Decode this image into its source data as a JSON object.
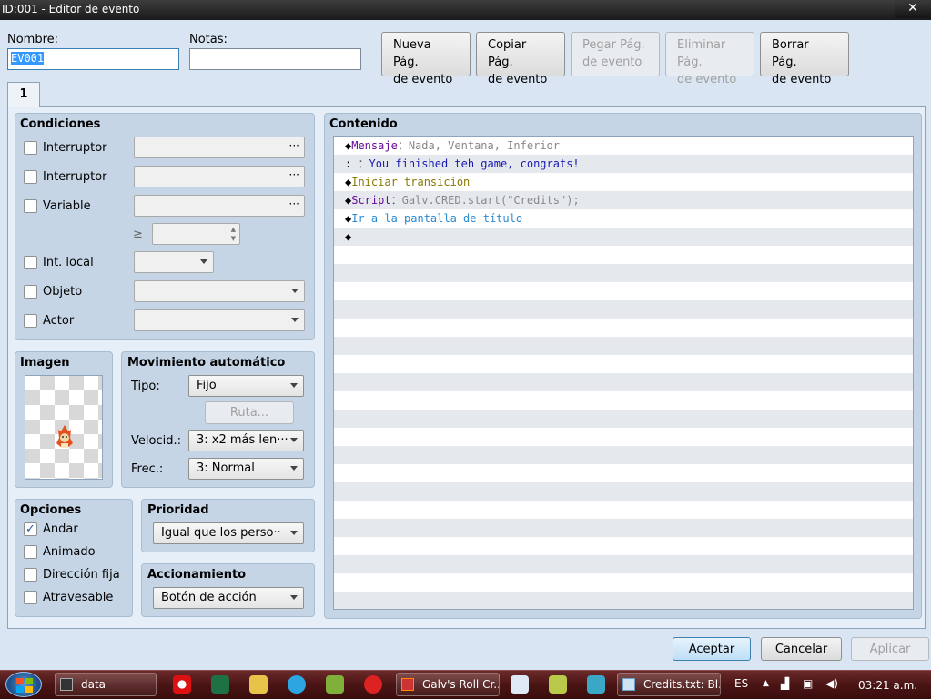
{
  "window": {
    "title": "ID:001 - Editor de evento",
    "close": "✕"
  },
  "form": {
    "name_label": "Nombre:",
    "name_value": "EV001",
    "notes_label": "Notas:",
    "notes_value": ""
  },
  "page_buttons": [
    {
      "line1": "Nueva Pág.",
      "line2": "de evento"
    },
    {
      "line1": "Copiar Pág.",
      "line2": "de evento"
    },
    {
      "line1": "Pegar Pág.",
      "line2": "de evento"
    },
    {
      "line1": "Eliminar Pág.",
      "line2": "de evento"
    },
    {
      "line1": "Borrar Pág.",
      "line2": "de evento"
    }
  ],
  "tabs": [
    "1"
  ],
  "conditions": {
    "title": "Condiciones",
    "switch1": "Interruptor",
    "switch2": "Interruptor",
    "variable": "Variable",
    "ge": "≥",
    "selfswitch": "Int. local",
    "item": "Objeto",
    "actor": "Actor",
    "dots": "···"
  },
  "image": {
    "title": "Imagen"
  },
  "movement": {
    "title": "Movimiento automático",
    "type_label": "Tipo:",
    "type_value": "Fijo",
    "route": "Ruta...",
    "speed_label": "Velocid.:",
    "speed_value": "3: x2 más len···",
    "freq_label": "Frec.:",
    "freq_value": "3: Normal"
  },
  "options": {
    "title": "Opciones",
    "walk": "Andar",
    "step": "Animado",
    "dirfix": "Dirección fija",
    "through": "Atravesable",
    "walk_checked": "✓"
  },
  "priority": {
    "title": "Prioridad",
    "value": "Igual que los perso···"
  },
  "trigger": {
    "title": "Accionamiento",
    "value": "Botón de acción"
  },
  "contents": {
    "title": "Contenido",
    "rows": [
      {
        "mark": "◆",
        "cmd": "Mensaje",
        "sep": "：",
        "arg": "Nada, Ventana, Inferior",
        "cmdcolor": "#6a0a9a",
        "argcolor": "#888888"
      },
      {
        "mark": " ",
        "cmd": ":",
        "sep": "      ：",
        "arg": "You finished teh game, congrats!",
        "cmdcolor": "#000000",
        "argcolor": "#1a1ab0"
      },
      {
        "mark": "◆",
        "cmd": "Iniciar transición",
        "sep": "",
        "arg": "",
        "cmdcolor": "#8a7a00",
        "argcolor": "#000000"
      },
      {
        "mark": "◆",
        "cmd": "Script",
        "sep": "：",
        "arg": "Galv.CRED.start(\"Credits\");",
        "cmdcolor": "#6a0a9a",
        "argcolor": "#888888"
      },
      {
        "mark": "◆",
        "cmd": "Ir a la pantalla de título",
        "sep": "",
        "arg": "",
        "cmdcolor": "#2a8ad0",
        "argcolor": "#000000"
      },
      {
        "mark": "◆",
        "cmd": "",
        "sep": "",
        "arg": "",
        "cmdcolor": "#000000",
        "argcolor": "#000000"
      }
    ]
  },
  "footer": {
    "ok": "Aceptar",
    "cancel": "Cancelar",
    "apply": "Aplicar"
  },
  "taskbar": {
    "items": [
      "data",
      "Galv's Roll Cr...",
      "Credits.txt: Bl..."
    ],
    "lang": "ES",
    "time": "03:21 a.m."
  }
}
